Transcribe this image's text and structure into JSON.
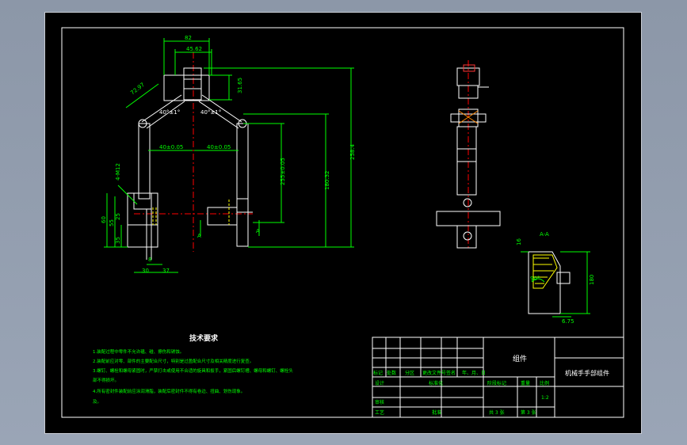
{
  "colors": {
    "background": "#000000",
    "outline": "#ffffff",
    "dimension": "#00ff00",
    "annotation": "#00ffff",
    "centerline": "#ff0000",
    "hidden": "#ffff00",
    "frame_outer": "#8c97a8"
  },
  "front_view": {
    "dims": {
      "top_width": "82",
      "inner_width": "45.62",
      "angle_link": "72.97",
      "top_height": "31.65",
      "angle_left": "40°±1°",
      "angle_right": "40°±1°",
      "left_offset": "40±0.05",
      "right_offset": "40±0.05",
      "hole_label": "4-M12",
      "height_mid": "255±0.05",
      "height_inner": "180.32",
      "height_total": "258.4",
      "left_60": "60",
      "left_55": "55",
      "left_25": "25",
      "left_35": "35",
      "bottom_8": "8",
      "bottom_30": "30",
      "bottom_37": "37"
    },
    "section_mark_left": "A",
    "section_mark_right": "A"
  },
  "section_view": {
    "label": "A-A",
    "dims": {
      "top_16": "16",
      "angle": "90°",
      "height": "180",
      "width": "6.75"
    }
  },
  "notes": {
    "title": "技术要求",
    "items": [
      "1.装配过程中零件不允许磕、碰、擦伤和锈蚀。",
      "2.装配前应对零、部件的主要配合尺寸，特别是过盈配合尺寸及相关精度进行复查。",
      "3.螺钉、螺栓和螺母紧固时，严禁打击或使用不合适的旋具和扳手，紧固后螺钉槽、螺母和螺钉、螺栓头",
      "部不得损坏。",
      "4.所有密封件装配前应涂润滑脂，装配后密封件不得有卷边、扭曲、划伤现象。",
      "及。"
    ]
  },
  "title_block": {
    "part_name": "组件",
    "drawing_name": "机械手手部组件",
    "header_row": [
      "标记",
      "处数",
      "分区",
      "更改文件号",
      "签名",
      "年、月、日"
    ],
    "design_label": "设计",
    "standardize_label": "标准化",
    "stage_label": "阶段标记",
    "weight_label": "重量",
    "scale_label": "比例",
    "scale_value": "1:2",
    "review_label": "审核",
    "process_label": "工艺",
    "approve_label": "批准",
    "sheets_total": "共 3 张",
    "sheet_number": "第 3 张"
  }
}
